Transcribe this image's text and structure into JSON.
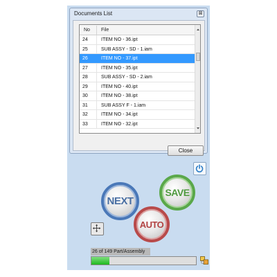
{
  "dialog": {
    "title": "Documents List",
    "close_glyph": "⊠",
    "columns": {
      "no": "No",
      "file": "File"
    },
    "rows": [
      {
        "no": "24",
        "file": "ITEM NO - 36.ipt"
      },
      {
        "no": "25",
        "file": "SUB ASSY - SD - 1.iam"
      },
      {
        "no": "26",
        "file": "ITEM NO - 37.ipt",
        "selected": true
      },
      {
        "no": "27",
        "file": "ITEM NO - 35.ipt"
      },
      {
        "no": "28",
        "file": "SUB ASSY - SD - 2.iam"
      },
      {
        "no": "29",
        "file": "ITEM NO - 40.ipt"
      },
      {
        "no": "30",
        "file": "ITEM NO - 38.ipt"
      },
      {
        "no": "31",
        "file": "SUB ASSY F - 1.iam"
      },
      {
        "no": "32",
        "file": "ITEM NO - 34.ipt"
      },
      {
        "no": "33",
        "file": "ITEM NO - 32.ipt"
      }
    ],
    "close_button_label": "Close"
  },
  "controls": {
    "next_label": "NEXT",
    "save_label": "SAVE",
    "auto_label": "AUTO"
  },
  "status": {
    "text": "26 of 149 Part/Assembly",
    "progress_fraction": 0.174
  },
  "icons": {
    "power": "power-icon",
    "move": "move-icon",
    "tile": "tile-icon",
    "scroll_up": "scroll-up-arrow-icon",
    "scroll_down": "scroll-down-arrow-icon"
  },
  "colors": {
    "panel_bg": "#c9dcf0",
    "selection": "#3399ff",
    "next_ring": "#4a78b8",
    "save_ring": "#5aa84a",
    "auto_ring": "#b84a4a",
    "progress_fill": "#1fb81f"
  }
}
